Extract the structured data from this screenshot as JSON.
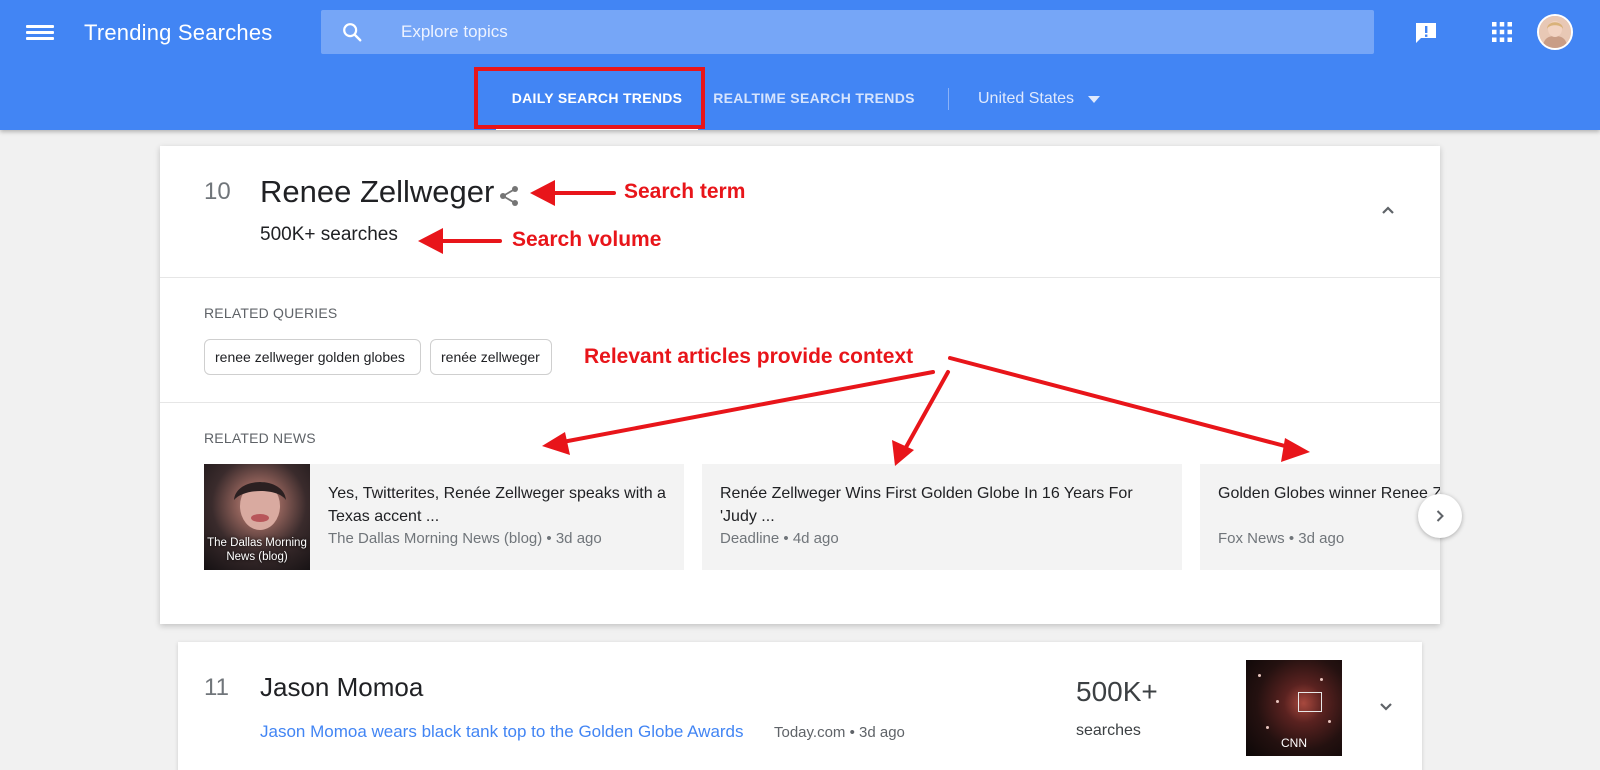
{
  "header": {
    "title": "Trending Searches",
    "search_placeholder": "Explore topics",
    "tabs": [
      {
        "label": "DAILY SEARCH TRENDS",
        "active": true
      },
      {
        "label": "REALTIME SEARCH TRENDS",
        "active": false
      }
    ],
    "region": "United States",
    "brand_color": "#4285f4"
  },
  "trend_main": {
    "rank": "10",
    "term": "Renee Zellweger",
    "volume": "500K+ searches",
    "related_queries_label": "RELATED QUERIES",
    "related_queries": [
      "renee zellweger golden globes",
      "renée zellweger"
    ],
    "related_news_label": "RELATED NEWS",
    "news": [
      {
        "title": "Yes, Twitterites, Renée Zellweger speaks with a Texas accent ...",
        "source": "The Dallas Morning News (blog)",
        "time": "3d ago",
        "thumb_label": "The Dallas Morning News (blog)"
      },
      {
        "title": "Renée Zellweger Wins First Golden Globe In 16 Years For 'Judy ...",
        "source": "Deadline",
        "time": "4d ago"
      },
      {
        "title": "Golden Globes winner Renee Zellweger with ...",
        "source": "Fox News",
        "time": "3d ago"
      }
    ]
  },
  "trend_next": {
    "rank": "11",
    "term": "Jason Momoa",
    "article_title": "Jason Momoa wears black tank top to the Golden Globe Awards",
    "article_source": "Today.com",
    "article_time": "3d ago",
    "volume_number": "500K+",
    "volume_word": "searches",
    "thumb_label": "CNN"
  },
  "annotations": {
    "search_term": "Search term",
    "search_volume": "Search volume",
    "articles": "Relevant articles provide context",
    "color": "#e8151a"
  }
}
